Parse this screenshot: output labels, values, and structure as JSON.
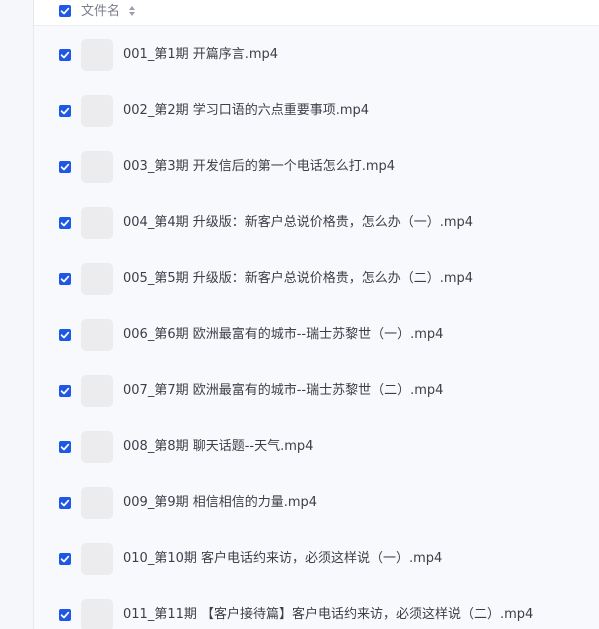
{
  "header": {
    "label": "文件名"
  },
  "colors": {
    "accent": "#1f58e6",
    "thumbnail": "#ececef"
  },
  "files": [
    {
      "name": "001_第1期 开篇序言.mp4",
      "checked": true
    },
    {
      "name": "002_第2期 学习口语的六点重要事项.mp4",
      "checked": true
    },
    {
      "name": "003_第3期 开发信后的第一个电话怎么打.mp4",
      "checked": true
    },
    {
      "name": "004_第4期 升级版：新客户总说价格贵，怎么办（一）.mp4",
      "checked": true
    },
    {
      "name": "005_第5期 升级版：新客户总说价格贵，怎么办（二）.mp4",
      "checked": true
    },
    {
      "name": "006_第6期 欧洲最富有的城市--瑞士苏黎世（一）.mp4",
      "checked": true
    },
    {
      "name": "007_第7期 欧洲最富有的城市--瑞士苏黎世（二）.mp4",
      "checked": true
    },
    {
      "name": "008_第8期 聊天话题--天气.mp4",
      "checked": true
    },
    {
      "name": "009_第9期 相信相信的力量.mp4",
      "checked": true
    },
    {
      "name": "010_第10期 客户电话约来访，必须这样说（一）.mp4",
      "checked": true
    },
    {
      "name": "011_第11期 【客户接待篇】客户电话约来访，必须这样说（二）.mp4",
      "checked": true
    }
  ]
}
